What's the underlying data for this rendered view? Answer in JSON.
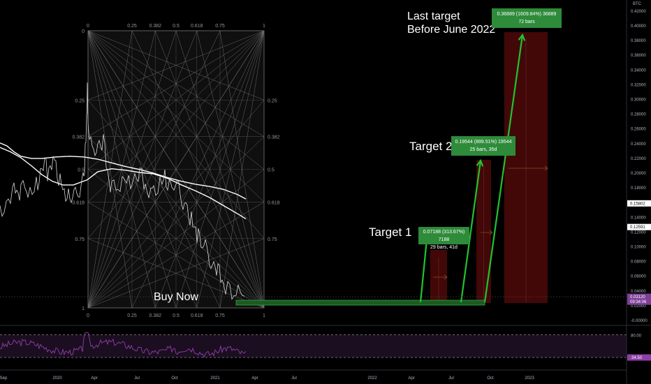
{
  "instrument": "BTC",
  "chart_data": [
    {
      "type": "line",
      "title": "",
      "x_ticks": [
        "Sep",
        "2020",
        "Apr",
        "Jul",
        "Oct",
        "2021",
        "Apr",
        "Jul",
        "2022",
        "Apr",
        "Jul",
        "Oct",
        "2023"
      ],
      "y_ticks": [
        "0.42000",
        "0.40000",
        "0.38000",
        "0.36000",
        "0.34000",
        "0.32000",
        "0.30000",
        "0.28000",
        "0.26000",
        "0.24000",
        "0.22000",
        "0.20000",
        "0.18000",
        "0.16000",
        "0.14000",
        "0.12000",
        "0.10000",
        "0.08000",
        "0.06000",
        "0.04000",
        "0.02000",
        "-0.00000"
      ],
      "ylim": [
        -0.002,
        0.424
      ],
      "price_badges": [
        {
          "label": "0.15802",
          "value": 0.15802,
          "style": "white"
        },
        {
          "label": "0.12591",
          "value": 0.12591,
          "style": "white"
        },
        {
          "label": "0.03120",
          "value": 0.0312,
          "style": "purple"
        }
      ],
      "countdown": "09:34:06",
      "series": [
        {
          "color": "#ffffff",
          "points": [
            [
              0,
              0.24
            ],
            [
              10,
              0.236
            ],
            [
              20,
              0.228
            ],
            [
              30,
              0.222
            ],
            [
              45,
              0.219
            ],
            [
              60,
              0.219
            ],
            [
              80,
              0.221
            ],
            [
              100,
              0.222
            ],
            [
              120,
              0.221
            ],
            [
              140,
              0.218
            ],
            [
              160,
              0.213
            ],
            [
              180,
              0.208
            ],
            [
              200,
              0.204
            ],
            [
              220,
              0.199
            ],
            [
              240,
              0.193
            ],
            [
              260,
              0.188
            ],
            [
              280,
              0.184
            ],
            [
              300,
              0.181
            ],
            [
              320,
              0.177
            ],
            [
              340,
              0.17
            ],
            [
              352,
              0.164
            ]
          ]
        },
        {
          "color": "#ffffff",
          "points": [
            [
              0,
              0.234
            ],
            [
              15,
              0.228
            ],
            [
              30,
              0.22
            ],
            [
              45,
              0.209
            ],
            [
              60,
              0.197
            ],
            [
              75,
              0.188
            ],
            [
              90,
              0.183
            ],
            [
              105,
              0.183
            ],
            [
              125,
              0.19
            ],
            [
              140,
              0.201
            ],
            [
              160,
              0.205
            ],
            [
              180,
              0.203
            ],
            [
              200,
              0.2
            ],
            [
              220,
              0.198
            ],
            [
              240,
              0.192
            ],
            [
              260,
              0.183
            ],
            [
              280,
              0.175
            ],
            [
              300,
              0.166
            ],
            [
              320,
              0.155
            ],
            [
              340,
              0.144
            ],
            [
              352,
              0.137
            ]
          ]
        }
      ],
      "price_path": [
        [
          0,
          0.155
        ],
        [
          6,
          0.15
        ],
        [
          12,
          0.16
        ],
        [
          18,
          0.168
        ],
        [
          22,
          0.18
        ],
        [
          26,
          0.172
        ],
        [
          30,
          0.176
        ],
        [
          36,
          0.19
        ],
        [
          40,
          0.17
        ],
        [
          46,
          0.166
        ],
        [
          52,
          0.182
        ],
        [
          56,
          0.194
        ],
        [
          60,
          0.205
        ],
        [
          64,
          0.212
        ],
        [
          68,
          0.2
        ],
        [
          72,
          0.213
        ],
        [
          76,
          0.218
        ],
        [
          80,
          0.204
        ],
        [
          84,
          0.19
        ],
        [
          88,
          0.183
        ],
        [
          92,
          0.17
        ],
        [
          96,
          0.176
        ],
        [
          100,
          0.168
        ],
        [
          104,
          0.162
        ],
        [
          108,
          0.168
        ],
        [
          112,
          0.175
        ],
        [
          116,
          0.182
        ],
        [
          119,
          0.192
        ],
        [
          121,
          0.21
        ],
        [
          123,
          0.245
        ],
        [
          124,
          0.275
        ],
        [
          125,
          0.31
        ],
        [
          126,
          0.275
        ],
        [
          128,
          0.245
        ],
        [
          132,
          0.228
        ],
        [
          136,
          0.235
        ],
        [
          140,
          0.243
        ],
        [
          144,
          0.232
        ],
        [
          148,
          0.24
        ],
        [
          152,
          0.215
        ],
        [
          156,
          0.19
        ],
        [
          160,
          0.18
        ],
        [
          166,
          0.188
        ],
        [
          172,
          0.178
        ],
        [
          178,
          0.187
        ],
        [
          184,
          0.184
        ],
        [
          190,
          0.195
        ],
        [
          196,
          0.19
        ],
        [
          200,
          0.198
        ],
        [
          206,
          0.189
        ],
        [
          210,
          0.18
        ],
        [
          216,
          0.175
        ],
        [
          220,
          0.17
        ],
        [
          226,
          0.18
        ],
        [
          232,
          0.184
        ],
        [
          236,
          0.196
        ],
        [
          240,
          0.188
        ],
        [
          246,
          0.184
        ],
        [
          252,
          0.18
        ],
        [
          256,
          0.175
        ],
        [
          260,
          0.165
        ],
        [
          264,
          0.158
        ],
        [
          268,
          0.148
        ],
        [
          272,
          0.14
        ],
        [
          276,
          0.13
        ],
        [
          280,
          0.122
        ],
        [
          284,
          0.112
        ],
        [
          288,
          0.106
        ],
        [
          292,
          0.101
        ],
        [
          296,
          0.093
        ],
        [
          300,
          0.085
        ],
        [
          304,
          0.078
        ],
        [
          308,
          0.068
        ],
        [
          312,
          0.064
        ],
        [
          316,
          0.059
        ],
        [
          320,
          0.049
        ],
        [
          326,
          0.044
        ],
        [
          332,
          0.04
        ],
        [
          338,
          0.037
        ],
        [
          344,
          0.034
        ],
        [
          350,
          0.032
        ]
      ]
    },
    {
      "type": "line",
      "title": "",
      "y_ticks": [
        "80.00",
        "34.50"
      ],
      "upper_band": 80,
      "lower_band": 34.5
    }
  ],
  "fib_box": {
    "top_labels": [
      "0",
      "0.25",
      "0.382",
      "0.5",
      "0.618",
      "0.75",
      "1"
    ],
    "bottom_labels": [
      "0",
      "0.25",
      "0.382",
      "0.5",
      "0.618",
      "0.75",
      "1"
    ],
    "left_labels": [
      "0",
      "0.25",
      "0.382",
      "0.5",
      "0.618",
      "0.75",
      "1"
    ],
    "right_labels": [
      "0.25",
      "0.382",
      "0.5",
      "0.618",
      "0.75"
    ]
  },
  "annotations": {
    "buy_now": "Buy Now",
    "target1": "Target 1",
    "target2": "Target 2",
    "last_target_line1": "Last target",
    "last_target_line2": "Before June 2022"
  },
  "boxes": [
    {
      "line1": "0.07188 (313.67%) 7188",
      "line2": "29 bars, 41d"
    },
    {
      "line1": "0.19544 (899.51%) 19544",
      "line2": "25 bars, 35d"
    },
    {
      "line1": "0.36889 (1609.84%) 36889",
      "line2": "72 bars"
    }
  ],
  "colors": {
    "up": "#22c32e",
    "green_box": "#2e8b3a",
    "purple": "#7e3f98",
    "rsi": "#8e3fa8"
  }
}
